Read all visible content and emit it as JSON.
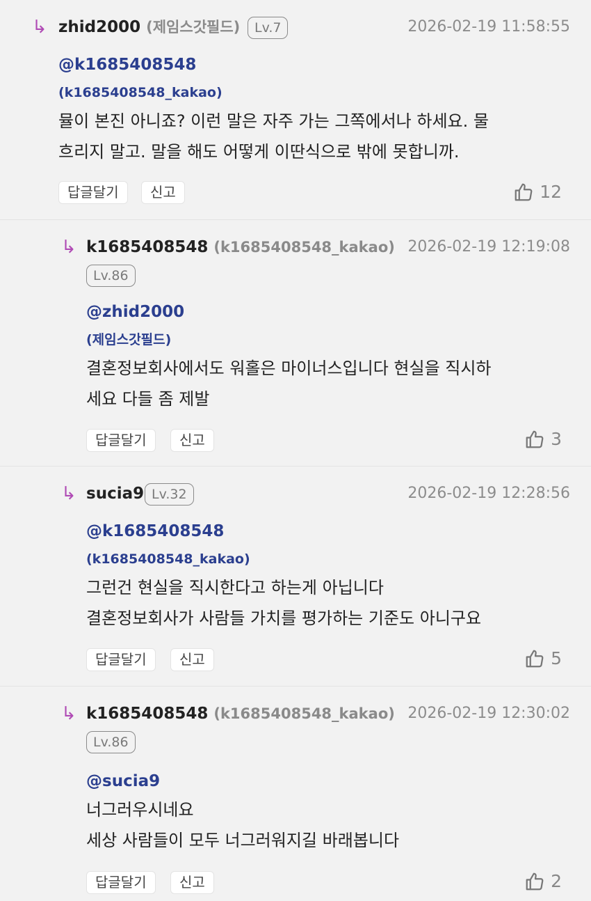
{
  "comments": [
    {
      "author": "zhid2000",
      "author_sub": "(제임스갓필드)",
      "level": "Lv.7",
      "time": "2026-02-19 11:58:55",
      "mention": "@k1685408548",
      "mention_sub": "(k1685408548_kakao)",
      "lines": [
        "뮬이 본진 아니죠? 이런 말은 자주 가는 그쪽에서나 하세요. 물",
        "흐리지 말고. 말을 해도 어떻게 이딴식으로 밖에 못합니까."
      ],
      "reply_label": "답글달기",
      "report_label": "신고",
      "likes": "12"
    },
    {
      "author": "k1685408548",
      "author_sub": "(k1685408548_kakao)",
      "level": "Lv.86",
      "time": "2026-02-19 12:19:08",
      "mention": "@zhid2000",
      "mention_sub": "(제임스갓필드)",
      "lines": [
        "결혼정보회사에서도 워홀은 마이너스입니다 현실을 직시하",
        "세요 다들 좀 제발"
      ],
      "reply_label": "답글달기",
      "report_label": "신고",
      "likes": "3"
    },
    {
      "author": "sucia9",
      "author_sub": "",
      "level": "Lv.32",
      "time": "2026-02-19 12:28:56",
      "mention": "@k1685408548",
      "mention_sub": "(k1685408548_kakao)",
      "lines": [
        "그런건 현실을 직시한다고 하는게 아닙니다",
        "결혼정보회사가 사람들 가치를 평가하는 기준도 아니구요"
      ],
      "reply_label": "답글달기",
      "report_label": "신고",
      "likes": "5"
    },
    {
      "author": "k1685408548",
      "author_sub": "(k1685408548_kakao)",
      "level": "Lv.86",
      "time": "2026-02-19 12:30:02",
      "mention": "@sucia9",
      "mention_sub": "",
      "lines": [
        "너그러우시네요",
        "세상 사람들이 모두 너그러워지길 바래봅니다"
      ],
      "reply_label": "답글달기",
      "report_label": "신고",
      "likes": "2"
    }
  ],
  "icons": {
    "reply_arrow": "reply-arrow-icon",
    "like": "thumbs-up-icon"
  },
  "colors": {
    "accent_arrow": "#b04bb5",
    "mention": "#2b3f8f",
    "background": "#f2f2f2"
  }
}
